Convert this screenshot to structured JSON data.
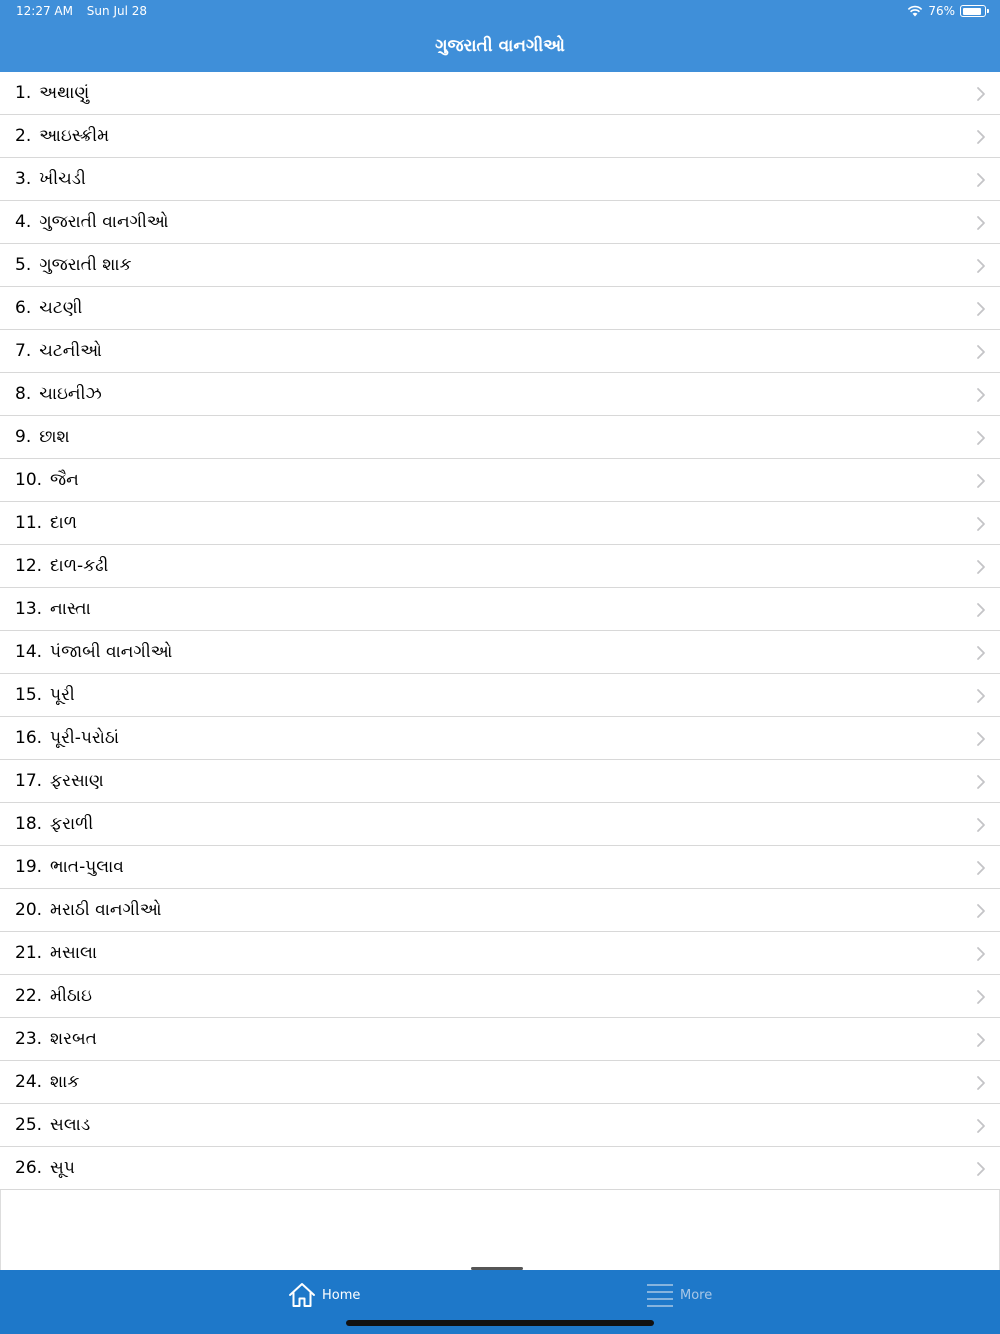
{
  "status_bar": {
    "time": "12:27 AM",
    "date": "Sun Jul 28",
    "battery": "76%",
    "battery_level": 0.76
  },
  "nav": {
    "title": "ગુજરાતી વાનગીઓ"
  },
  "items": [
    {
      "num": "1.",
      "label": "અથાણું"
    },
    {
      "num": "2.",
      "label": "આઇસ્ક્રીમ"
    },
    {
      "num": "3.",
      "label": "ખીચડી"
    },
    {
      "num": "4.",
      "label": "ગુજરાતી વાનગીઓ"
    },
    {
      "num": "5.",
      "label": "ગુજરાતી શાક"
    },
    {
      "num": "6.",
      "label": "ચટણી"
    },
    {
      "num": "7.",
      "label": "ચટનીઓ"
    },
    {
      "num": "8.",
      "label": "ચાઇનીઝ"
    },
    {
      "num": "9.",
      "label": "છાશ"
    },
    {
      "num": "10.",
      "label": "જૈન"
    },
    {
      "num": "11.",
      "label": "દાળ"
    },
    {
      "num": "12.",
      "label": "દાળ-કઢી"
    },
    {
      "num": "13.",
      "label": "નાસ્તા"
    },
    {
      "num": "14.",
      "label": "પંજાબી વાનગીઓ"
    },
    {
      "num": "15.",
      "label": "પૂરી"
    },
    {
      "num": "16.",
      "label": "પૂરી-પરોઠાં"
    },
    {
      "num": "17.",
      "label": "ફરસાણ"
    },
    {
      "num": "18.",
      "label": "ફરાળી"
    },
    {
      "num": "19.",
      "label": "ભાત-પુલાવ"
    },
    {
      "num": "20.",
      "label": "મરાઠી વાનગીઓ"
    },
    {
      "num": "21.",
      "label": "મસાલા"
    },
    {
      "num": "22.",
      "label": "મીઠાઇ"
    },
    {
      "num": "23.",
      "label": "શરબત"
    },
    {
      "num": "24.",
      "label": "શાક"
    },
    {
      "num": "25.",
      "label": "સલાડ"
    },
    {
      "num": "26.",
      "label": "સૂપ"
    }
  ],
  "tabbar": {
    "home": {
      "label": "Home",
      "icon": "home-icon",
      "active": true
    },
    "more": {
      "label": "More",
      "icon": "menu-lines-icon",
      "active": false
    }
  },
  "colors": {
    "nav_bg": "#3f8fd9",
    "tabbar_bg": "#1e78c9",
    "tab_active": "#ffffff",
    "tab_inactive": "#a9c7e6"
  }
}
